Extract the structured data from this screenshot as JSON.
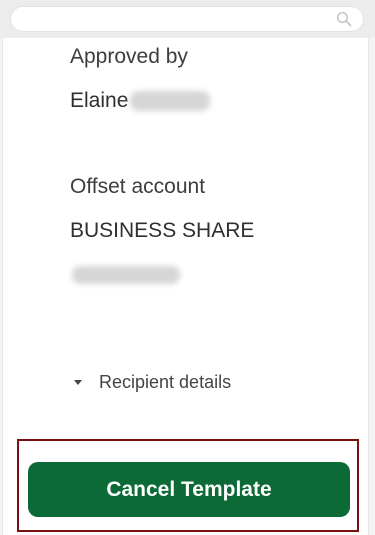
{
  "search": {
    "placeholder": ""
  },
  "details": {
    "approved_by_label": "Approved by",
    "approved_by_first_name": "Elaine",
    "offset_account_label": "Offset account",
    "offset_account_name": "BUSINESS SHARE"
  },
  "recipient": {
    "label": "Recipient details",
    "icon": "caret-down-icon"
  },
  "actions": {
    "cancel_label": "Cancel Template"
  },
  "colors": {
    "primary_button": "#0c6a36",
    "highlight_border": "#7a1010"
  },
  "icons": {
    "search": "search-icon"
  }
}
